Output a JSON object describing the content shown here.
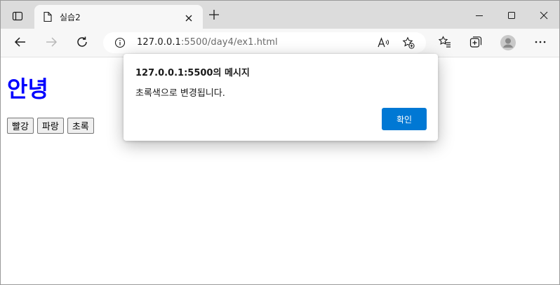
{
  "tab": {
    "title": "실습2"
  },
  "address": {
    "host": "127.0.0.1",
    "rest": ":5500/day4/ex1.html"
  },
  "page": {
    "heading": "안녕",
    "buttons": [
      "빨강",
      "파랑",
      "초록"
    ]
  },
  "dialog": {
    "title": "127.0.0.1:5500의 메시지",
    "message": "초록색으로 변경됩니다.",
    "ok_label": "확인"
  },
  "colors": {
    "heading": "#0000ff",
    "accent": "#0078d4"
  },
  "icons": [
    "tab-actions-icon",
    "page-icon",
    "close-icon",
    "plus-icon",
    "minimize-icon",
    "maximize-icon",
    "window-close-icon",
    "back-icon",
    "forward-icon",
    "refresh-icon",
    "info-icon",
    "read-aloud-icon",
    "add-favorite-icon",
    "favorites-icon",
    "collections-icon",
    "profile-icon",
    "more-icon"
  ]
}
